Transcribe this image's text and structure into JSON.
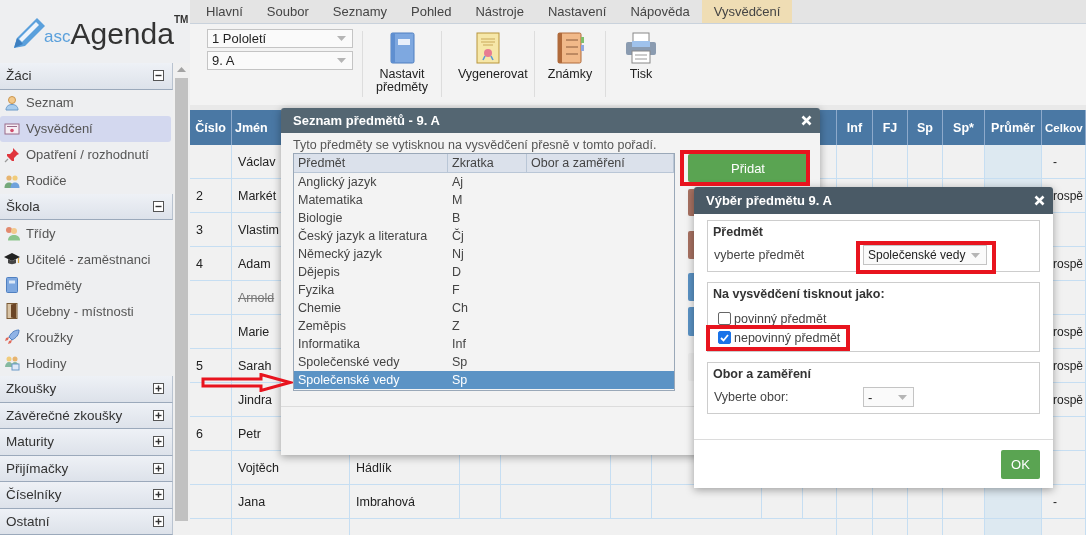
{
  "logo": {
    "prefix": "asc",
    "name": "Agenda",
    "mark": "TM"
  },
  "sidebar": {
    "sections": [
      {
        "title": "Žáci",
        "expanded": true,
        "items": [
          {
            "label": "Seznam",
            "selected": false
          },
          {
            "label": "Vysvědčení",
            "selected": true
          },
          {
            "label": "Opatření / rozhodnutí",
            "selected": false
          },
          {
            "label": "Rodiče",
            "selected": false
          }
        ]
      },
      {
        "title": "Škola",
        "expanded": true,
        "items": [
          {
            "label": "Třídy",
            "selected": false
          },
          {
            "label": "Učitelé - zaměstnanci",
            "selected": false
          },
          {
            "label": "Předměty",
            "selected": false
          },
          {
            "label": "Učebny - místnosti",
            "selected": false
          },
          {
            "label": "Kroužky",
            "selected": false
          },
          {
            "label": "Hodiny",
            "selected": false
          }
        ]
      },
      {
        "title": "Zkoušky",
        "expanded": false
      },
      {
        "title": "Závěrečné zkoušky",
        "expanded": false
      },
      {
        "title": "Maturity",
        "expanded": false
      },
      {
        "title": "Přijímačky",
        "expanded": false
      },
      {
        "title": "Číselníky",
        "expanded": false
      },
      {
        "title": "Ostatní",
        "expanded": false
      }
    ]
  },
  "menu_tabs": [
    {
      "label": "Hlavní",
      "selected": false
    },
    {
      "label": "Soubor",
      "selected": false
    },
    {
      "label": "Seznamy",
      "selected": false
    },
    {
      "label": "Pohled",
      "selected": false
    },
    {
      "label": "Nástroje",
      "selected": false
    },
    {
      "label": "Nastavení",
      "selected": false
    },
    {
      "label": "Nápověda",
      "selected": false
    },
    {
      "label": "Vysvědčení",
      "selected": true
    }
  ],
  "ribbon": {
    "selects": [
      {
        "value": "1 Pololetí"
      },
      {
        "value": "9. A"
      }
    ],
    "buttons": [
      {
        "label": "Nastavit předměty"
      },
      {
        "label": "Vygenerovat"
      },
      {
        "label": "Známky"
      },
      {
        "label": "Tisk"
      }
    ]
  },
  "table": {
    "columns": [
      {
        "label": "Číslo"
      },
      {
        "label": "Jmén"
      },
      {
        "label": "Inf"
      },
      {
        "label": "FJ"
      },
      {
        "label": "Sp"
      },
      {
        "label": "Sp*"
      },
      {
        "label": "Průměr"
      },
      {
        "label": "Celkov"
      }
    ],
    "rows": [
      {
        "first_name": "Václav",
        "withdrawn": false,
        "overall": "-"
      },
      {
        "number": "2",
        "first_name": "Markét",
        "withdrawn": false,
        "overall": "rospě"
      },
      {
        "number": "3",
        "first_name": "Vlastim",
        "withdrawn": false
      },
      {
        "number": "4",
        "first_name": "Adam",
        "withdrawn": false,
        "overall": "rospě"
      },
      {
        "first_name": "Arnold",
        "withdrawn": true
      },
      {
        "first_name": "Marie",
        "withdrawn": false,
        "overall": "rospě"
      },
      {
        "number": "5",
        "first_name": "Sarah",
        "withdrawn": false,
        "overall": "rospě"
      },
      {
        "first_name": "Jindra",
        "withdrawn": false,
        "overall": "rospě"
      },
      {
        "number": "6",
        "first_name": "Petr",
        "withdrawn": false
      },
      {
        "first_name": "Vojtěch",
        "last_name": "Hádlík",
        "withdrawn": false
      },
      {
        "first_name": "Jana",
        "last_name": "Imbrahová",
        "withdrawn": false,
        "overall": "-"
      }
    ]
  },
  "subject_list_dialog": {
    "title": "Seznam předmětů - 9. A",
    "hint": "Tyto předměty se vytisknou na vysvědčení přesně v tomto pořadí.",
    "columns": [
      "Předmět",
      "Zkratka",
      "Obor a zaměření"
    ],
    "rows": [
      {
        "subject": "Anglický jazyk",
        "abbr": "Aj",
        "selected": false
      },
      {
        "subject": "Matematika",
        "abbr": "M",
        "selected": false
      },
      {
        "subject": "Biologie",
        "abbr": "B",
        "selected": false
      },
      {
        "subject": "Český jazyk a literatura",
        "abbr": "Čj",
        "selected": false
      },
      {
        "subject": "Německý jazyk",
        "abbr": "Nj",
        "selected": false
      },
      {
        "subject": "Dějepis",
        "abbr": "D",
        "selected": false
      },
      {
        "subject": "Fyzika",
        "abbr": "F",
        "selected": false
      },
      {
        "subject": "Chemie",
        "abbr": "Ch",
        "selected": false
      },
      {
        "subject": "Zeměpis",
        "abbr": "Z",
        "selected": false
      },
      {
        "subject": "Informatika",
        "abbr": "Inf",
        "selected": false
      },
      {
        "subject": "Společenské vedy",
        "abbr": "Sp",
        "selected": false
      },
      {
        "subject": "Společenské vedy",
        "abbr": "Sp",
        "selected": true
      }
    ],
    "add_button": "Přidat"
  },
  "subject_pick_dialog": {
    "title": "Výběr předmětu 9. A",
    "subject_group": {
      "legend": "Předmět",
      "label": "vyberte předmět",
      "value": "Společenské vedy"
    },
    "print_group": {
      "legend": "Na vysvědčení tisknout jako:",
      "options": [
        {
          "label": "povinný předmět",
          "checked": false
        },
        {
          "label": "nepovinný předmět",
          "checked": true
        }
      ]
    },
    "field_group": {
      "legend": "Obor a zaměření",
      "label": "Vyberte obor:",
      "value": "-"
    },
    "ok_button": "OK"
  }
}
